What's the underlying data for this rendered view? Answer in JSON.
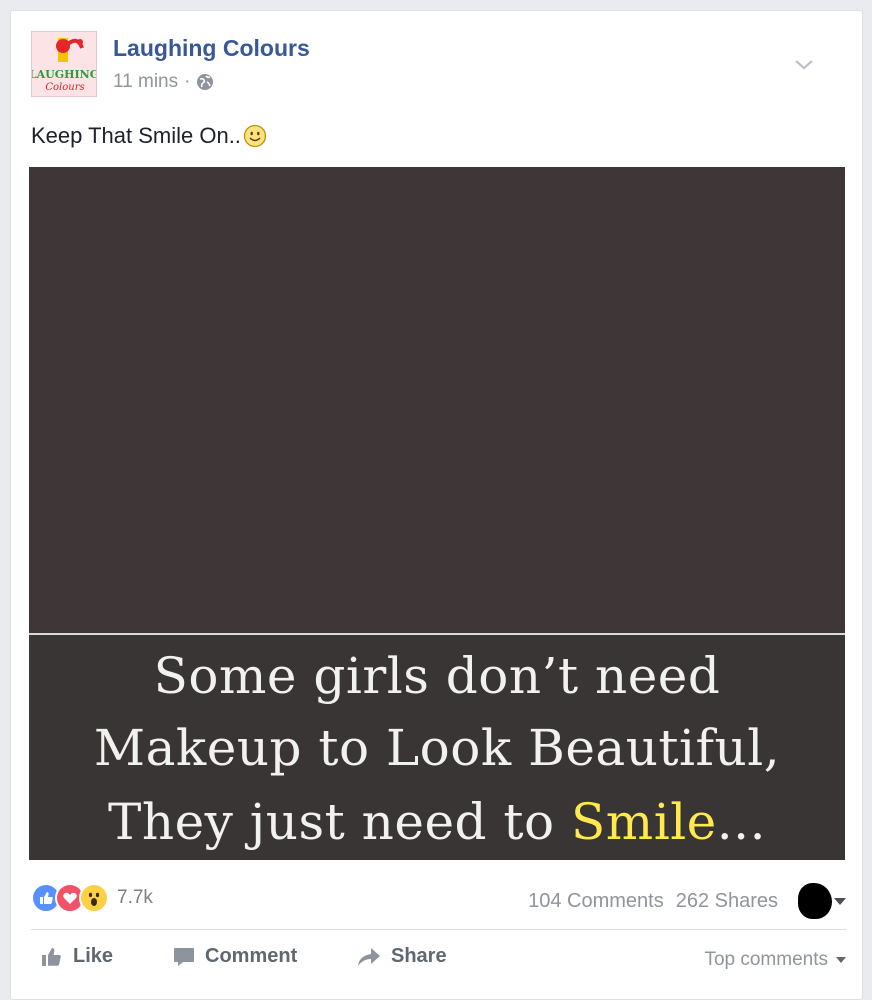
{
  "post": {
    "page_name": "Laughing Colours",
    "avatar": {
      "logo_line1": "LAUGHING",
      "logo_line2": "Colours"
    },
    "time": "11 mins",
    "meta_separator": "·",
    "privacy_icon": "globe-icon",
    "menu_icon": "chevron-down-icon",
    "text": "Keep That Smile On..",
    "text_emoji": "smiley-icon",
    "image": {
      "background_color": "#3f3737",
      "quote_line1": "Some girls don’t need",
      "quote_line2": "Makeup to Look Beautiful,",
      "quote_line3_prefix": "They just need to ",
      "quote_line3_highlight": "Smile",
      "quote_line3_suffix": "...",
      "highlight_color": "#ffe94d"
    }
  },
  "stats": {
    "reactions": [
      "like-reaction-icon",
      "love-reaction-icon",
      "wow-reaction-icon"
    ],
    "reaction_count": "7.7k",
    "comments": "104 Comments",
    "shares": "262 Shares"
  },
  "actions": {
    "like": "Like",
    "comment": "Comment",
    "share": "Share",
    "top_comments": "Top comments"
  },
  "colors": {
    "link_blue": "#385898",
    "muted_gray": "#90949c",
    "action_gray": "#616770"
  }
}
